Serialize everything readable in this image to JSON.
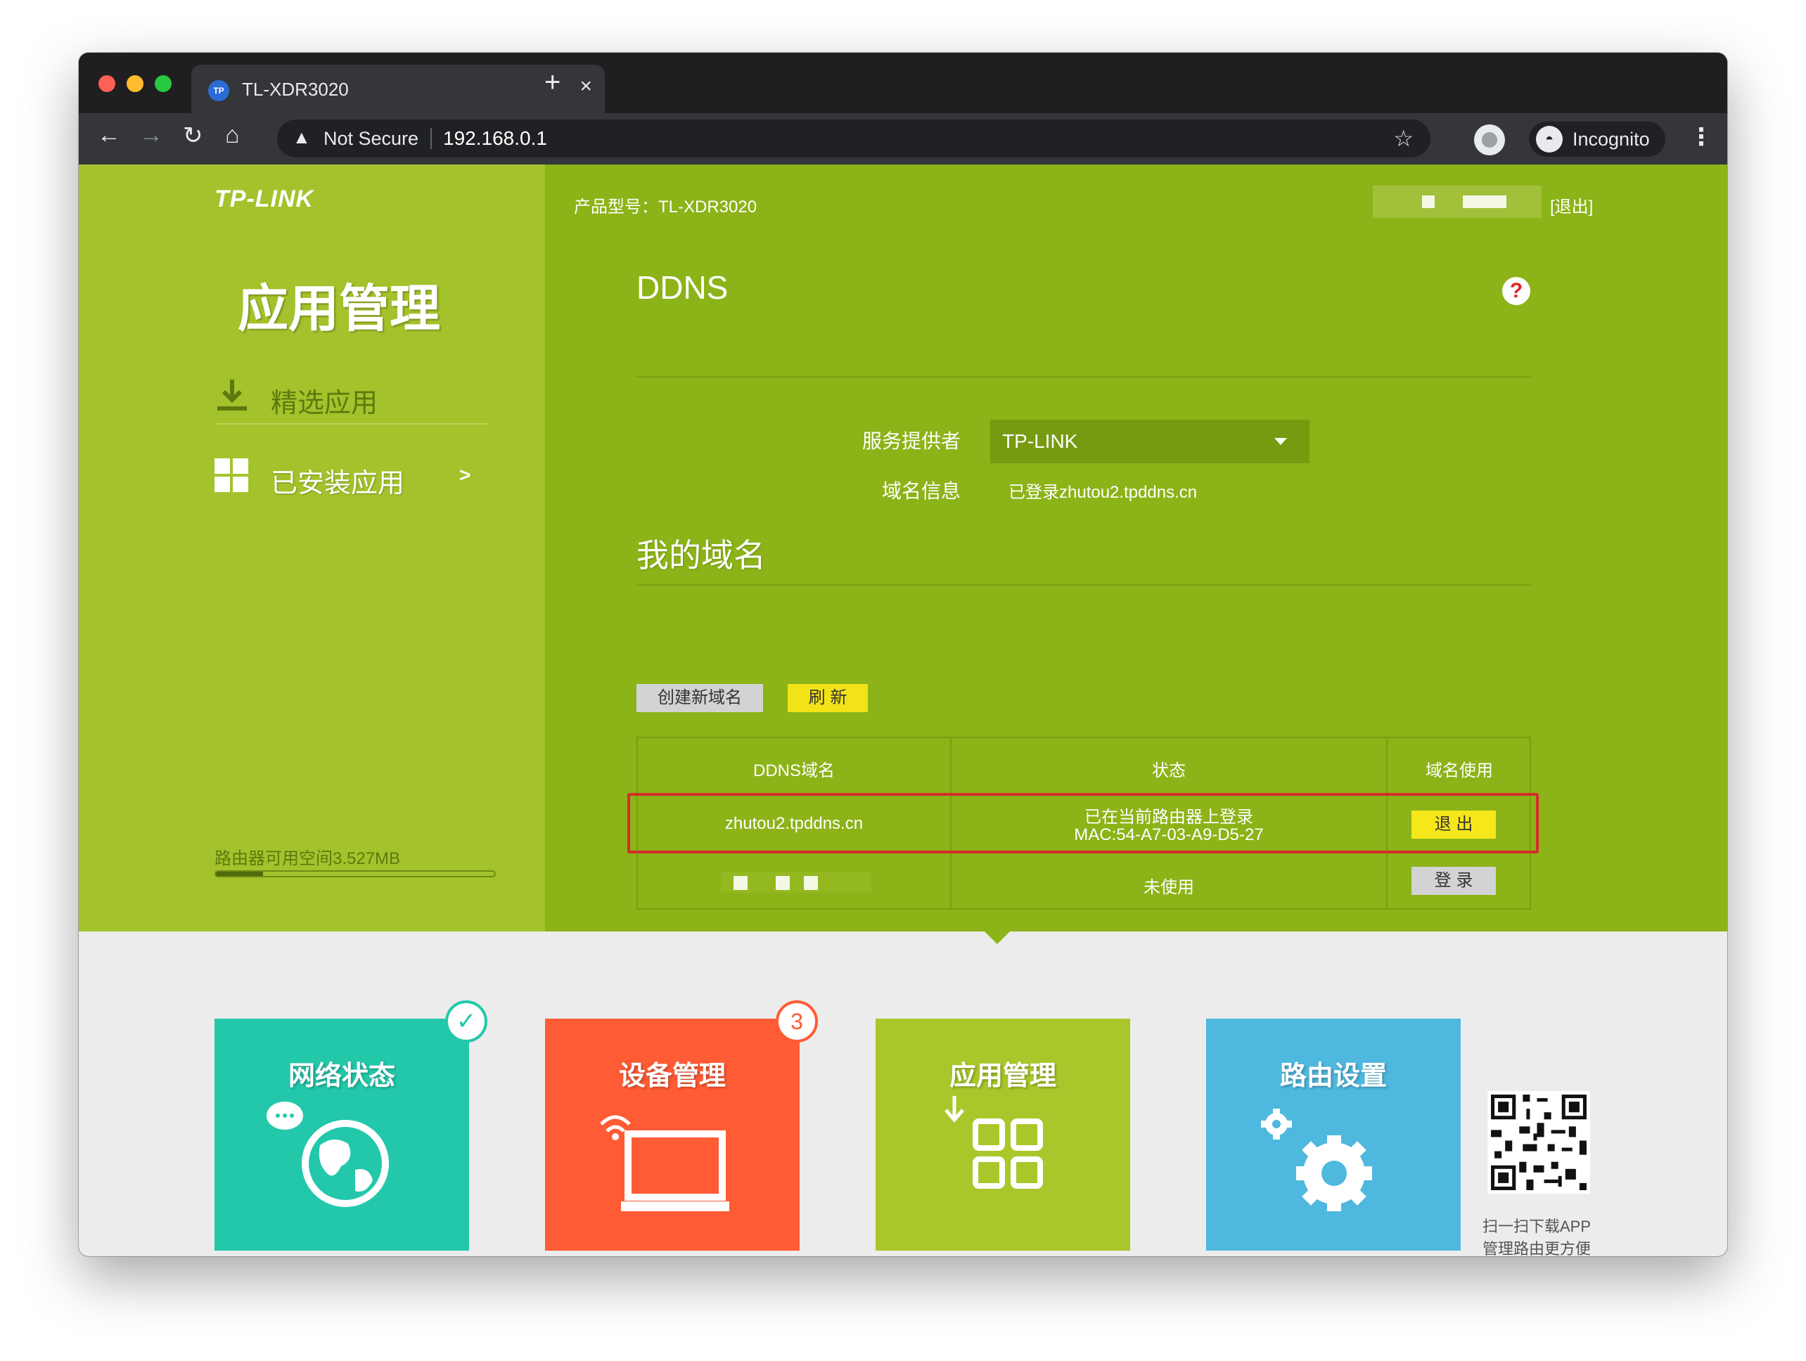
{
  "browser": {
    "tab_title": "TL-XDR3020",
    "favicon_text": "TP",
    "security_label": "Not Secure",
    "url": "192.168.0.1",
    "incognito_label": "Incognito"
  },
  "header": {
    "logo": "TP-LINK",
    "model_label": "产品型号：TL-XDR3020",
    "logout_link": "[退出]"
  },
  "sidebar": {
    "title": "应用管理",
    "items": [
      {
        "label": "精选应用",
        "icon": "download-icon"
      },
      {
        "label": "已安装应用",
        "icon": "grid-icon",
        "chevron": ">"
      }
    ],
    "storage_label": "路由器可用空间3.527MB",
    "storage_fraction": 0.17
  },
  "ddns": {
    "title": "DDNS",
    "help_symbol": "?",
    "provider_label": "服务提供者",
    "provider_value": "TP-LINK",
    "domain_label": "域名信息",
    "domain_value": "已登录zhutou2.tpddns.cn"
  },
  "my_domains": {
    "title": "我的域名",
    "create_button": "创建新域名",
    "refresh_button": "刷 新",
    "columns": [
      "DDNS域名",
      "状态",
      "域名使用"
    ],
    "rows": [
      {
        "domain": "zhutou2.tpddns.cn",
        "status_line1": "已在当前路由器上登录",
        "status_line2": "MAC:54-A7-03-A9-D5-27",
        "action": "退 出"
      },
      {
        "domain": "",
        "status_line1": "未使用",
        "status_line2": "",
        "action": "登 录"
      }
    ]
  },
  "tiles": [
    {
      "label": "网络状态",
      "color": "#23c8ab",
      "badge": "✓"
    },
    {
      "label": "设备管理",
      "color": "#ff5b35",
      "badge": "3"
    },
    {
      "label": "应用管理",
      "color": "#a9c72a"
    },
    {
      "label": "路由设置",
      "color": "#4fb8de"
    }
  ],
  "qr": {
    "line1": "扫一扫下载APP",
    "line2": "管理路由更方便"
  },
  "colors": {
    "green_main": "#8cb317",
    "green_sidebar": "#a4c22b",
    "highlight_red": "#d22e2a",
    "yellow_button": "#f6e71b"
  }
}
